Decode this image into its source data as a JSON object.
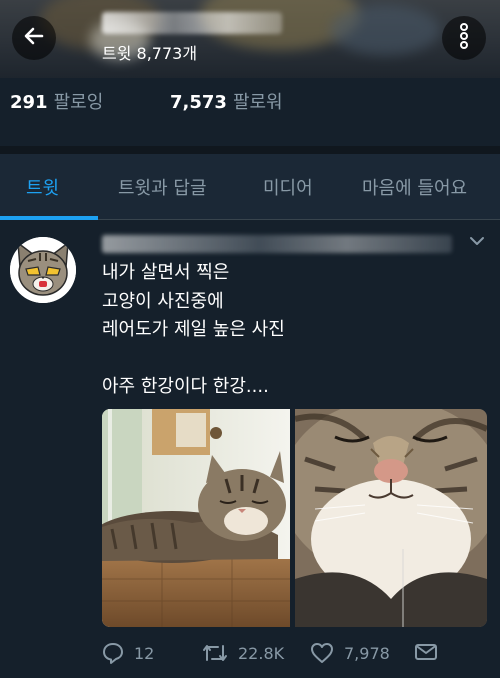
{
  "header": {
    "tweet_count_label": "트윗 8,773개",
    "back_icon": "arrow-left-icon",
    "more_icon": "vertical-dots-icon"
  },
  "stats": {
    "following_count": "291",
    "following_label": "팔로잉",
    "followers_count": "7,573",
    "followers_label": "팔로워"
  },
  "tabs": [
    {
      "label": "트윗",
      "active": true
    },
    {
      "label": "트윗과 답글",
      "active": false
    },
    {
      "label": "미디어",
      "active": false
    },
    {
      "label": "마음에 들어요",
      "active": false
    }
  ],
  "tweet": {
    "text_lines": [
      "내가 살면서 찍은",
      "고양이 사진중에",
      "레어도가 제일 높은 사진",
      "",
      "아주 한강이다 한강...."
    ],
    "actions": {
      "reply_count": "12",
      "retweet_count": "22.8K",
      "like_count": "7,978"
    }
  },
  "colors": {
    "background": "#15202b",
    "tab_bar": "#1b2836",
    "accent": "#1da1f2",
    "secondary_text": "#8899a6"
  }
}
